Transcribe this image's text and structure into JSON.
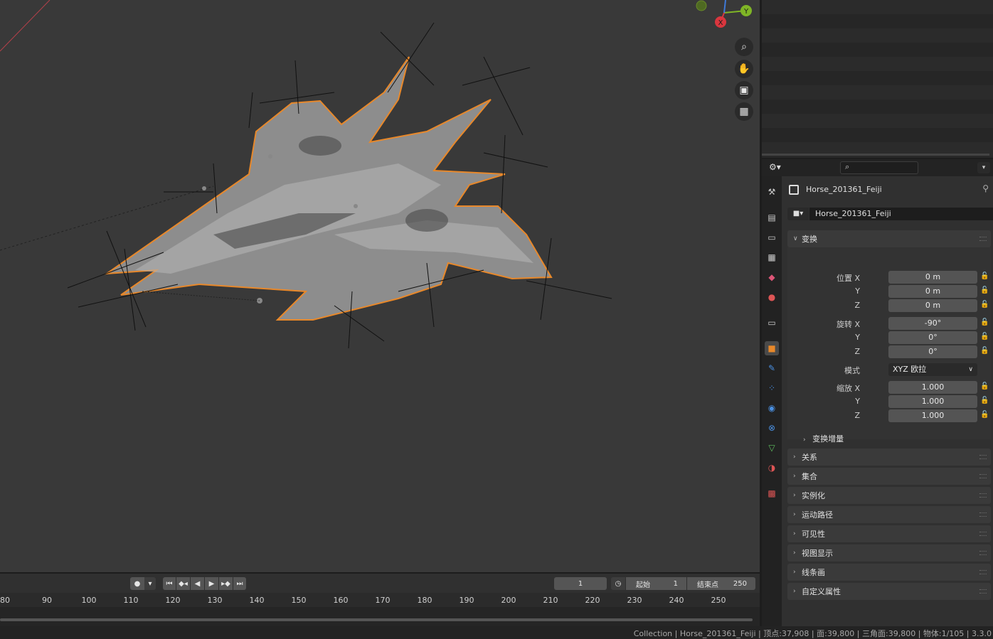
{
  "viewport": {
    "zoom_icon": "zoom-in-icon",
    "pan_icon": "hand-icon",
    "camera_icon": "camera-icon",
    "ortho_icon": "grid-view-icon",
    "gizmo_x": "X",
    "gizmo_y": "Y",
    "outline_color": "#e8882a",
    "axis_x_color": "#d9363e",
    "axis_y_color": "#7fb526"
  },
  "properties": {
    "search_placeholder": "",
    "object_name": "Horse_201361_Feiji",
    "object_field_value": "Horse_201361_Feiji",
    "transform": {
      "title": "变换",
      "location_label": "位置 X",
      "location": [
        "0 m",
        "0 m",
        "0 m"
      ],
      "rotation_label": "旋转 X",
      "rotation": [
        "-90°",
        "0°",
        "0°"
      ],
      "mode_label": "模式",
      "mode_value": "XYZ 欧拉",
      "scale_label": "缩放 X",
      "scale": [
        "1.000",
        "1.000",
        "1.000"
      ],
      "y_label": "Y",
      "z_label": "Z",
      "delta_title": "变换增量"
    },
    "panels": [
      "关系",
      "集合",
      "实例化",
      "运动路径",
      "可见性",
      "视图显示",
      "线条画",
      "自定义属性"
    ]
  },
  "timeline": {
    "current_frame": "1",
    "start_label": "起始",
    "start_value": "1",
    "end_label": "结束点",
    "end_value": "250",
    "ticks": [
      "80",
      "90",
      "100",
      "110",
      "120",
      "130",
      "140",
      "150",
      "160",
      "170",
      "180",
      "190",
      "200",
      "210",
      "220",
      "230",
      "240",
      "250"
    ]
  },
  "statusbar": {
    "text": "Collection | Horse_201361_Feiji | 顶点:37,908 | 面:39,800 | 三角面:39,800 | 物体:1/105 | 3.3.0"
  }
}
